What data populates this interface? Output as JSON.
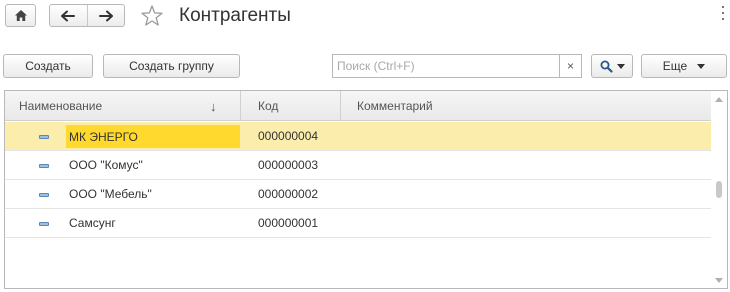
{
  "window": {
    "title": "Контрагенты"
  },
  "nav": {
    "home_icon": "home-icon",
    "back_icon": "arrow-left-icon",
    "forward_icon": "arrow-right-icon",
    "favorite_icon": "star-icon"
  },
  "toolbar": {
    "create_label": "Создать",
    "create_group_label": "Создать группу",
    "search_placeholder": "Поиск (Ctrl+F)",
    "search_clear": "×",
    "more_label": "Еще"
  },
  "table": {
    "columns": [
      "Наименование",
      "Код",
      "Комментарий"
    ],
    "sort_indicator": "↓",
    "rows": [
      {
        "name": "МК ЭНЕРГО",
        "code": "000000004",
        "comment": "",
        "selected": true
      },
      {
        "name": "ООО \"Комус\"",
        "code": "000000003",
        "comment": ""
      },
      {
        "name": "ООО \"Мебель\"",
        "code": "000000002",
        "comment": ""
      },
      {
        "name": "Самсунг",
        "code": "000000001",
        "comment": ""
      }
    ]
  },
  "colors": {
    "selected_row": "#fbedac",
    "selected_cell": "#ffd92e"
  }
}
